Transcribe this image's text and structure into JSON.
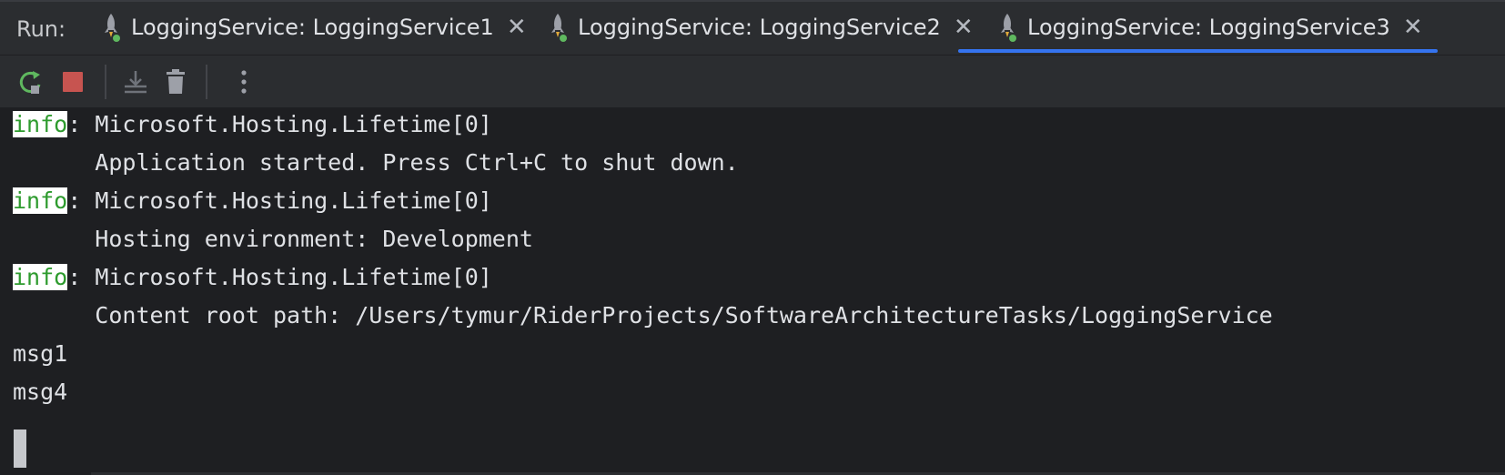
{
  "tabbar": {
    "run_label": "Run:",
    "tabs": [
      {
        "label": "LoggingService: LoggingService1",
        "icon": "rocket-run-icon",
        "active": false
      },
      {
        "label": "LoggingService: LoggingService2",
        "icon": "rocket-run-icon",
        "active": false
      },
      {
        "label": "LoggingService: LoggingService3",
        "icon": "rocket-run-icon",
        "active": true
      }
    ],
    "close_glyph": "✕",
    "accent_color": "#3574f0"
  },
  "toolbar": {
    "buttons": [
      {
        "name": "rerun-icon",
        "color": "#5fb85f"
      },
      {
        "name": "stop-icon",
        "color": "#c75450"
      },
      {
        "name": "scroll-to-end-icon",
        "color": "#6f737a"
      },
      {
        "name": "clear-all-icon",
        "color": "#9da0a8"
      },
      {
        "name": "more-options-icon",
        "color": "#9da0a8"
      }
    ]
  },
  "console": {
    "lines": [
      {
        "level": "info",
        "rest": ": Microsoft.Hosting.Lifetime[0]"
      },
      {
        "text": "      Application started. Press Ctrl+C to shut down."
      },
      {
        "level": "info",
        "rest": ": Microsoft.Hosting.Lifetime[0]"
      },
      {
        "text": "      Hosting environment: Development"
      },
      {
        "level": "info",
        "rest": ": Microsoft.Hosting.Lifetime[0]"
      },
      {
        "text": "      Content root path: /Users/tymur/RiderProjects/SoftwareArchitectureTasks/LoggingService"
      },
      {
        "text": "msg1"
      },
      {
        "text": "msg4"
      }
    ],
    "level_color": "#2e9b2e"
  }
}
